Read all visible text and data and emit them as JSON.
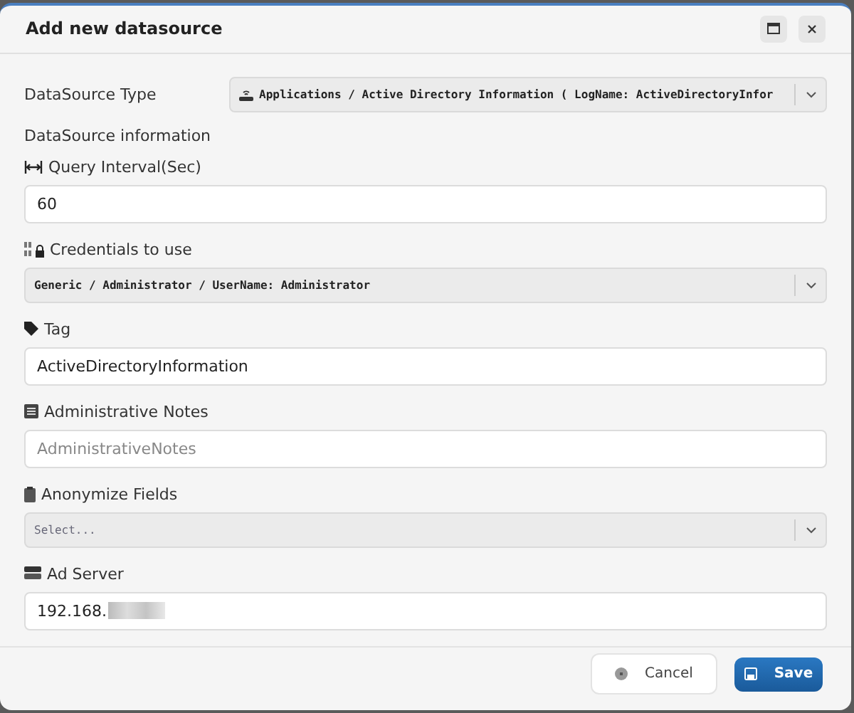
{
  "dialog": {
    "title": "Add new datasource"
  },
  "datasource_type": {
    "label": "DataSource Type",
    "value": "Applications / Active Directory Information ( LogName: ActiveDirectoryInfor"
  },
  "section_label": "DataSource information",
  "fields": [
    {
      "label": "Query Interval(Sec)",
      "kind": "input",
      "value": "60"
    },
    {
      "label": "Credentials to use",
      "kind": "select",
      "value": "Generic / Administrator / UserName: Administrator"
    },
    {
      "label": "Tag",
      "kind": "input",
      "value": "ActiveDirectoryInformation"
    },
    {
      "label": "Administrative Notes",
      "kind": "input",
      "placeholder": "AdministrativeNotes"
    },
    {
      "label": "Anonymize Fields",
      "kind": "select",
      "placeholder": "Select..."
    },
    {
      "label": "Ad Server",
      "kind": "input",
      "value": "192.168.",
      "redacted": true
    }
  ],
  "buttons": [
    {
      "label": "Cancel",
      "kind": "secondary"
    },
    {
      "label": "Save",
      "kind": "primary"
    }
  ]
}
